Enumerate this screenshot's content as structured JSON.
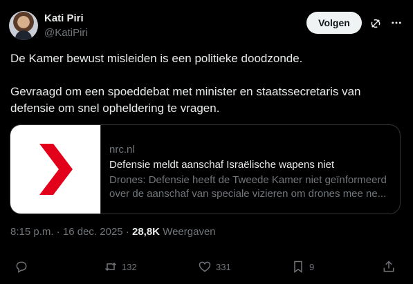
{
  "author": {
    "name": "Kati Piri",
    "handle": "@KatiPiri",
    "follow_label": "Volgen"
  },
  "tweet": {
    "paragraphs": [
      "De Kamer bewust misleiden is een politieke doodzonde.",
      "Gevraagd om een spoeddebat met minister en staatssecretaris van defensie om snel opheldering te vragen."
    ]
  },
  "card": {
    "domain": "nrc.nl",
    "title": "Defensie meldt aanschaf Israëlische wapens niet",
    "description": "Drones: Defensie heeft de Tweede Kamer niet geïnformeerd over de aanschaf van speciale vizieren om drones mee ne...",
    "logo_color": "#e3001b"
  },
  "meta": {
    "time": "8:15 p.m.",
    "separator": " · ",
    "date": "16 dec. 2025",
    "views_count": "28,8K",
    "views_label": "Weergaven"
  },
  "actions": {
    "reply_icon": "reply-icon",
    "retweets": "132",
    "likes": "331",
    "bookmarks": "9",
    "share_icon": "share-icon"
  },
  "colors": {
    "background": "#000000",
    "text": "#e7e9ea",
    "muted": "#71767b",
    "border": "#2f3336",
    "button_bg": "#eff3f4"
  }
}
